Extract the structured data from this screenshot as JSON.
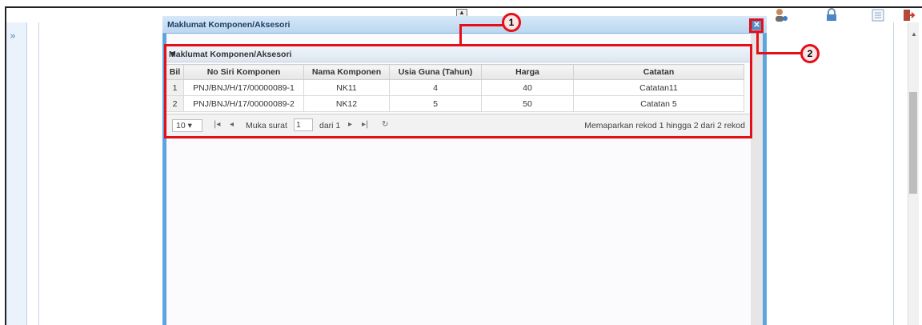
{
  "app": {
    "expand_glyph": "»",
    "top_toggle_glyph": "▲",
    "header_icons": [
      "user-settings-icon",
      "lock-icon",
      "list-view-icon",
      "logout-icon"
    ]
  },
  "dialog": {
    "title": "Maklumat Komponen/Aksesori",
    "close_glyph": "✕"
  },
  "panel": {
    "title": "Maklumat Komponen/Aksesori",
    "collapse_glyph": "▼"
  },
  "table": {
    "columns": [
      "Bil",
      "No Siri Komponen",
      "Nama Komponen",
      "Usia Guna (Tahun)",
      "Harga",
      "Catatan"
    ],
    "rows": [
      [
        "1",
        "PNJ/BNJ/H/17/00000089-1",
        "NK11",
        "4",
        "40",
        "Catatan11"
      ],
      [
        "2",
        "PNJ/BNJ/H/17/00000089-2",
        "NK12",
        "5",
        "50",
        "Catatan 5"
      ]
    ]
  },
  "pager": {
    "page_size": "10 ▾",
    "first_glyph": "|◂",
    "prev_glyph": "◂",
    "page_label": "Muka surat",
    "page_value": "1",
    "of_label": "dari 1",
    "next_glyph": "▸",
    "last_glyph": "▸|",
    "refresh_glyph": "↻",
    "record_info": "Memaparkan rekod 1 hingga 2 dari 2 rekod"
  },
  "callouts": [
    "1",
    "2"
  ],
  "colors": {
    "callout_red": "#e3101a",
    "dialog_blue": "#5ea5df"
  }
}
